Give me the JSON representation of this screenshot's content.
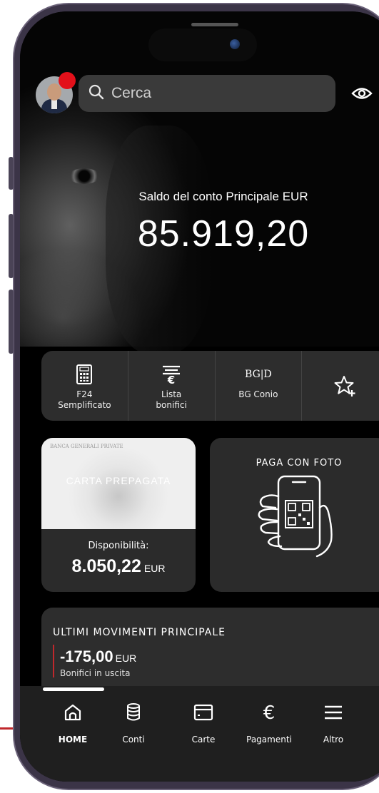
{
  "search": {
    "placeholder": "Cerca"
  },
  "balance": {
    "label": "Saldo del conto Principale EUR",
    "value": "85.919,20"
  },
  "quick_actions": [
    {
      "label": "F24\nSemplificato",
      "icon": "f24-calculator-icon"
    },
    {
      "label": "Lista\nbonifici",
      "icon": "euro-transfer-list-icon"
    },
    {
      "label": "BG Conio",
      "icon": "bg-conio-logo-icon",
      "glyph": "BG|D"
    },
    {
      "label": "",
      "icon": "add-favorite-star-icon"
    }
  ],
  "card": {
    "logo_text": "BANCA GENERALI PRIVATE",
    "name": "CARTA PREPAGATA",
    "available_label": "Disponibilità:",
    "available_amount": "8.050,22",
    "currency": "EUR"
  },
  "pay_photo": {
    "title": "PAGA CON FOTO",
    "icon": "phone-qr-hand-icon"
  },
  "movements": {
    "title": "ULTIMI MOVIMENTI PRINCIPALE",
    "amount": "-175,00",
    "currency": "EUR",
    "description": "Bonifici in uscita"
  },
  "nav": {
    "items": [
      {
        "label": "HOME",
        "icon": "home-icon",
        "active": true
      },
      {
        "label": "Conti",
        "icon": "accounts-stack-icon",
        "active": false
      },
      {
        "label": "Carte",
        "icon": "card-icon",
        "active": false
      },
      {
        "label": "Pagamenti",
        "icon": "euro-icon",
        "active": false
      },
      {
        "label": "Altro",
        "icon": "menu-icon",
        "active": false
      }
    ]
  },
  "colors": {
    "accent_red": "#e3101a",
    "movement_bar": "#c0282c",
    "panel": "#2d2d2d",
    "background": "#000000"
  }
}
